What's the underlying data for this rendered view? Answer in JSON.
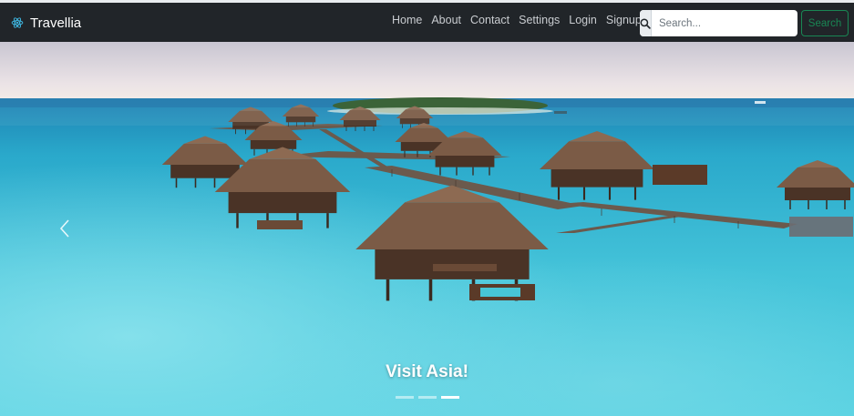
{
  "navbar": {
    "brand": "Travellia",
    "links": [
      "Home",
      "About",
      "Contact",
      "Settings",
      "Login",
      "Signup"
    ]
  },
  "search": {
    "placeholder": "Search...",
    "button_label": "Search"
  },
  "carousel": {
    "caption": "Visit Asia!",
    "slide_count": 3,
    "active_slide": 3
  },
  "icons": {
    "brand": "atom-icon",
    "search": "search-icon",
    "prev": "chevron-left-icon"
  },
  "colors": {
    "navbar_bg": "#212529",
    "search_button_accent": "#198754",
    "water": "#3fc3d6",
    "roof": "#7a5a45"
  }
}
